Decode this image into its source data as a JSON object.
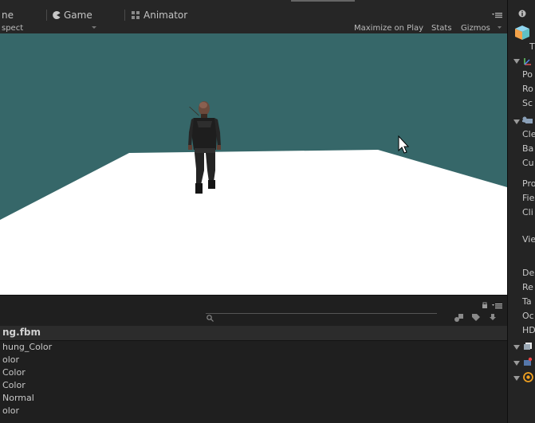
{
  "tabs": {
    "scene_label": "ne",
    "game_label": "Game",
    "animator_label": "Animator"
  },
  "toolbar": {
    "aspect_label": "spect",
    "maximize_on_play": "Maximize on Play",
    "stats": "Stats",
    "gizmos": "Gizmos"
  },
  "viewport": {
    "sky_color": "#366769",
    "ground_color": "#ffffff"
  },
  "project": {
    "asset_title": "ng.fbm",
    "assets": [
      "hung_Color",
      "olor",
      "Color",
      "Color",
      "Normal",
      "olor"
    ]
  },
  "inspector": {
    "rows": {
      "r1": "T",
      "r2": "Po",
      "r3": "Ro",
      "r4": "Sc",
      "r5": "Cle",
      "r6": "Ba",
      "r7": "Cu",
      "r8": "Pro",
      "r9": "Fie",
      "r10": "Cli",
      "r11": "Vie",
      "r12": "De",
      "r13": "Re",
      "r14": "Ta",
      "r15": "Oc",
      "r16": "HD"
    }
  }
}
